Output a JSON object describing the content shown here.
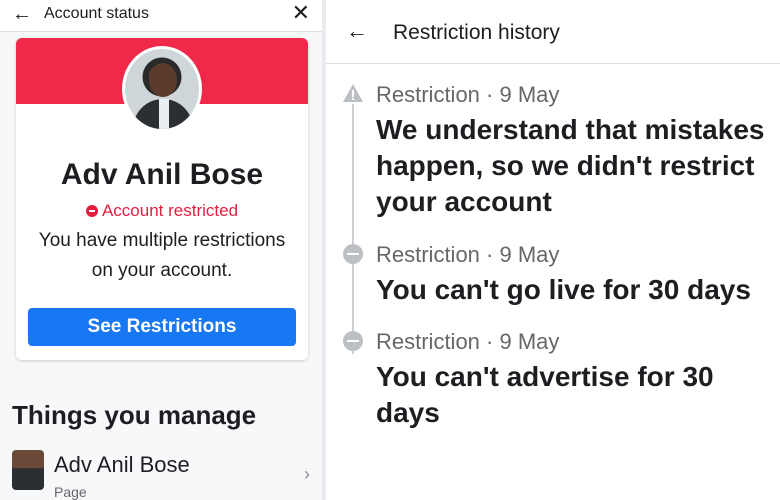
{
  "left_panel": {
    "header": {
      "back_icon": "arrow-left-icon",
      "title": "Account status",
      "close_icon": "close-icon"
    },
    "card": {
      "name": "Adv Anil Bose",
      "status": "Account restricted",
      "description": "You have multiple restrictions on your account.",
      "button_label": "See Restrictions",
      "banner_color": "#f02849",
      "button_color": "#1877f2"
    },
    "things_title": "Things you manage",
    "managed_page": {
      "name": "Adv Anil Bose",
      "type": "Page",
      "chevron": "›"
    }
  },
  "right_panel": {
    "header": {
      "back_icon": "arrow-left-icon",
      "title": "Restriction history"
    },
    "items": [
      {
        "icon": "warning-icon",
        "meta": "Restriction · 9 May",
        "headline": "We understand that mistakes happen, so we didn't restrict your account"
      },
      {
        "icon": "minus-circle-icon",
        "meta": "Restriction · 9 May",
        "headline": "You can't go live for 30 days"
      },
      {
        "icon": "minus-circle-icon",
        "meta": "Restriction · 9 May",
        "headline": "You can't advertise for 30 days"
      }
    ]
  }
}
